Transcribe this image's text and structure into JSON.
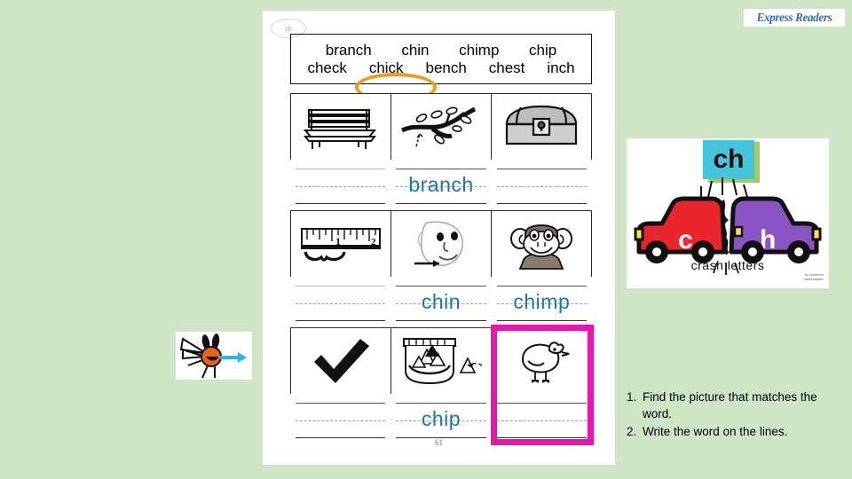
{
  "brand": {
    "logo_text": "Express Readers"
  },
  "worksheet": {
    "digraph_badge": "ch",
    "page_number": "61",
    "word_bank": {
      "row1": [
        "branch",
        "chin",
        "chimp",
        "chip"
      ],
      "row2": [
        "check",
        "chick",
        "bench",
        "chest",
        "inch"
      ],
      "circled_word": "chick"
    },
    "rows": [
      {
        "pictures": [
          {
            "icon": "bench-icon",
            "label": "bench"
          },
          {
            "icon": "branch-icon",
            "label": "branch"
          },
          {
            "icon": "treasure-chest-icon",
            "label": "chest"
          }
        ],
        "answers": [
          "",
          "branch",
          ""
        ],
        "highlighted_index": -1
      },
      {
        "pictures": [
          {
            "icon": "ruler-inch-icon",
            "label": "inch"
          },
          {
            "icon": "face-chin-icon",
            "label": "chin"
          },
          {
            "icon": "chimp-icon",
            "label": "chimp"
          }
        ],
        "answers": [
          "",
          "chin",
          "chimp"
        ],
        "highlighted_index": -1
      },
      {
        "pictures": [
          {
            "icon": "checkmark-icon",
            "label": "check"
          },
          {
            "icon": "chip-bag-icon",
            "label": "chip"
          },
          {
            "icon": "chick-icon",
            "label": "chick"
          }
        ],
        "answers": [
          "",
          "chip",
          ""
        ],
        "highlighted_index": 2
      }
    ]
  },
  "crash_letters": {
    "digraph": "ch",
    "caption": "crash letters",
    "left_car_letter": "c",
    "right_car_letter": "h",
    "credit": "by Maureen\nhaberstadter"
  },
  "bug_card": {
    "icon": "cartoon-bug-icon",
    "arrow": "right-arrow"
  },
  "instructions": [
    {
      "num": "1.",
      "text": "Find the picture that matches the word."
    },
    {
      "num": "2.",
      "text": "Write the word on the lines."
    }
  ],
  "colors": {
    "background": "#cfe6c6",
    "answer_blue": "#1d74a6",
    "highlight_magenta": "#ea15ae",
    "circle_orange": "#f29a18",
    "cyan_block": "#46c3dd",
    "green_block": "#9ccd6a",
    "car_red": "#e8262b",
    "car_purple": "#8b54c4"
  }
}
